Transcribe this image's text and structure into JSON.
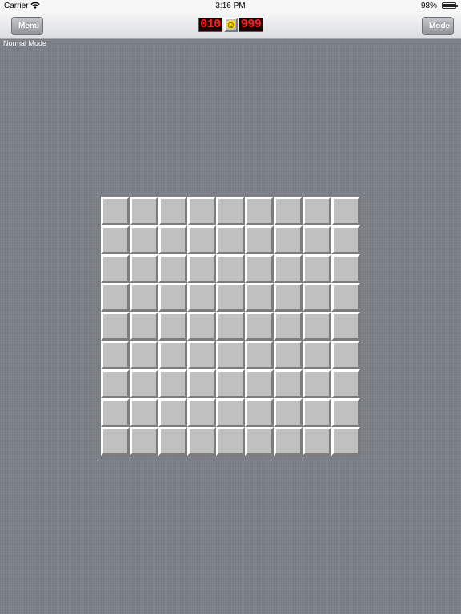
{
  "status_bar": {
    "carrier": "Carrier",
    "time": "3:16 PM",
    "battery_percent": "98%",
    "battery_level": 0.98
  },
  "toolbar": {
    "menu_label": "Menu",
    "mode_label": "Mode",
    "mine_counter": "010",
    "timer": "999",
    "face_state": "smiley-face-icon"
  },
  "game": {
    "mode_text": "Normal Mode",
    "rows": 9,
    "cols": 9,
    "cell_state": "unrevealed",
    "colors": {
      "background": "#7c8087",
      "cell": "#c0c0c0",
      "counter_digits": "#ff2020",
      "face": "#ffe000"
    }
  }
}
